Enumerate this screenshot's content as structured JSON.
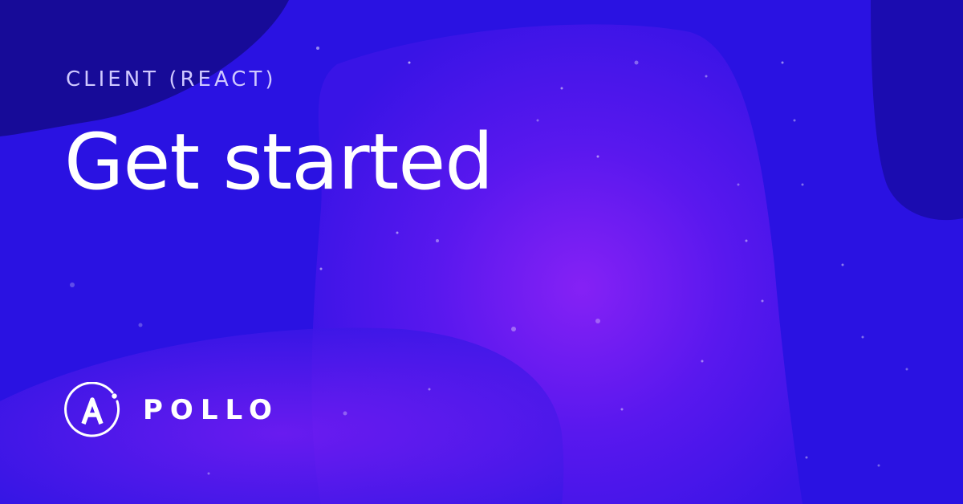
{
  "header": {
    "eyebrow": "CLIENT (REACT)",
    "title": "Get started"
  },
  "brand": {
    "logo_text": "APOLLO",
    "logo_icon": "apollo-logo-icon"
  },
  "colors": {
    "background_blue": "#2a10e6",
    "background_purple": "#7a1af2",
    "dark_navy": "#150a8a",
    "eyebrow_text": "#cfc8ff",
    "title_text": "#ffffff"
  }
}
